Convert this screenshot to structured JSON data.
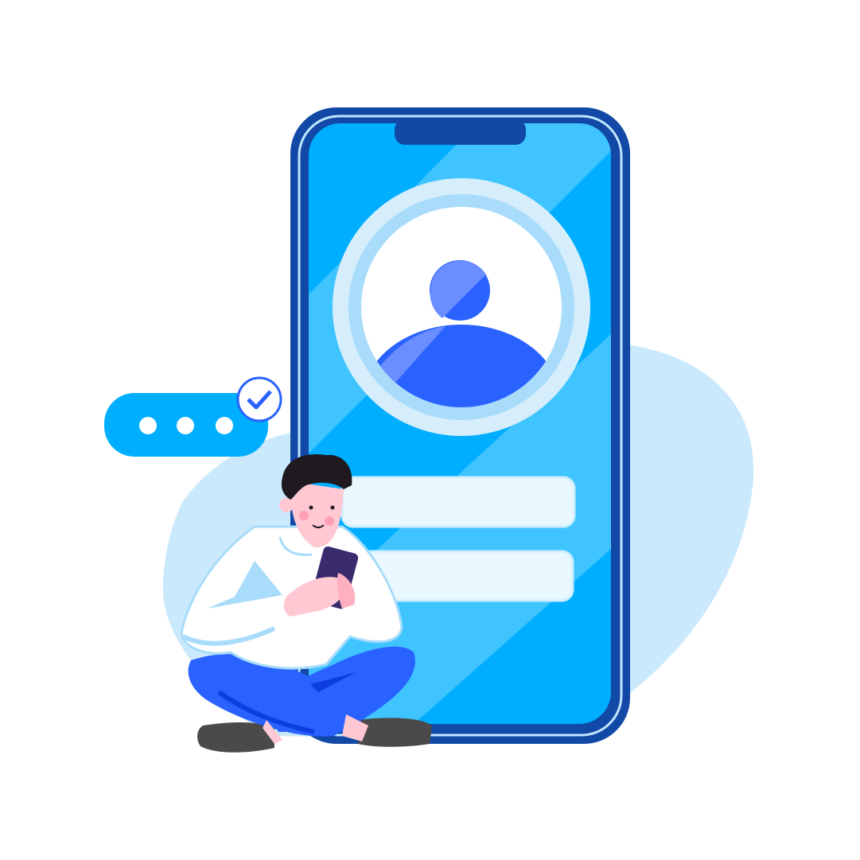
{
  "illustration": {
    "subject": "person-with-smartphone-profile-login",
    "colors": {
      "background": "#ffffff",
      "blob": "#cbe9fc",
      "phone_frame": "#1249a6",
      "phone_screen": "#00aeff",
      "screen_stripe": "#40c4ff",
      "avatar_accent": "#2962ff",
      "input_field": "#e9f8ff",
      "chat_bubble": "#00aeff",
      "pants": "#2962ff",
      "shirt": "#ffffff",
      "hair": "#1e1a1f",
      "skin": "#ffc8d3",
      "shoes": "#4a4a4a"
    },
    "icons": [
      "user-avatar-icon",
      "typing-dots-icon",
      "check-badge-icon"
    ],
    "chat_bubble_dots": 3,
    "input_fields": 2
  }
}
